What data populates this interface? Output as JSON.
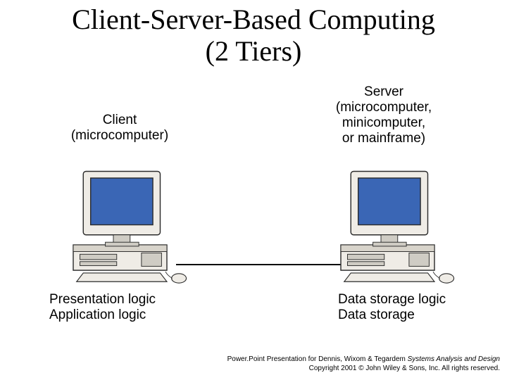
{
  "title": "Client-Server-Based Computing\n(2 Tiers)",
  "client": {
    "label": "Client\n(microcomputer)",
    "caption": "Presentation logic\nApplication logic"
  },
  "server": {
    "label": "Server\n(microcomputer,\nminicomputer,\nor mainframe)",
    "caption": "Data storage logic\nData storage"
  },
  "footer": {
    "line1_prefix": "Power.Point Presentation for Dennis, Wixom & Tegardem ",
    "book_title": "Systems Analysis and Design",
    "line2": "Copyright 2001 © John Wiley & Sons, Inc. All rights reserved."
  },
  "colors": {
    "screen": "#3a66b5",
    "case_light": "#efece6",
    "case_dark": "#c9c5bc",
    "outline": "#2b2b2b"
  }
}
